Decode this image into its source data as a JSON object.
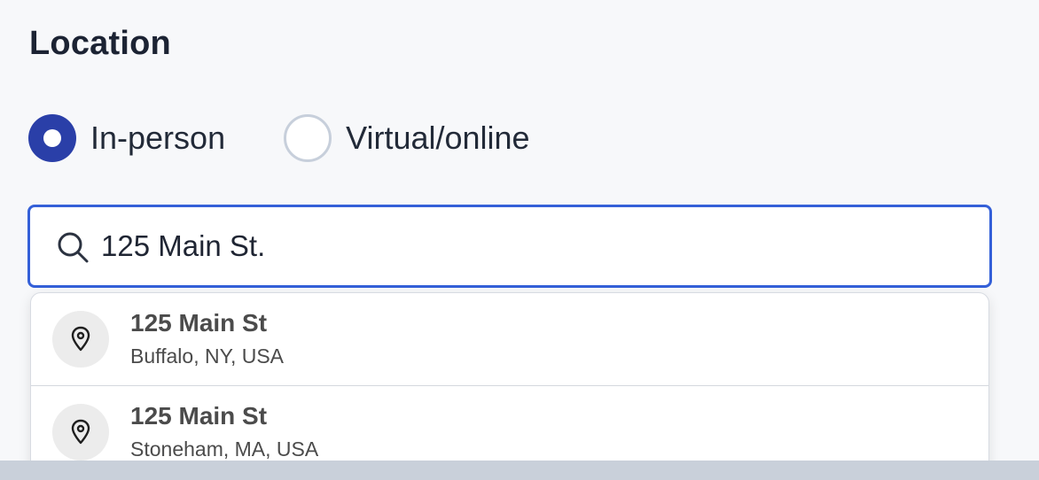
{
  "location": {
    "heading": "Location",
    "options": [
      {
        "label": "In-person",
        "checked": true
      },
      {
        "label": "Virtual/online",
        "checked": false
      }
    ],
    "search": {
      "value": "125 Main St.",
      "icon": "search-icon"
    },
    "suggestions": [
      {
        "title": "125 Main St",
        "subtitle": "Buffalo, NY, USA",
        "icon": "map-pin-icon"
      },
      {
        "title": "125 Main St",
        "subtitle": "Stoneham, MA, USA",
        "icon": "map-pin-icon"
      }
    ]
  },
  "colors": {
    "accent": "#2a3fa8",
    "focus_border": "#3460d8",
    "background": "#f7f8fa"
  }
}
